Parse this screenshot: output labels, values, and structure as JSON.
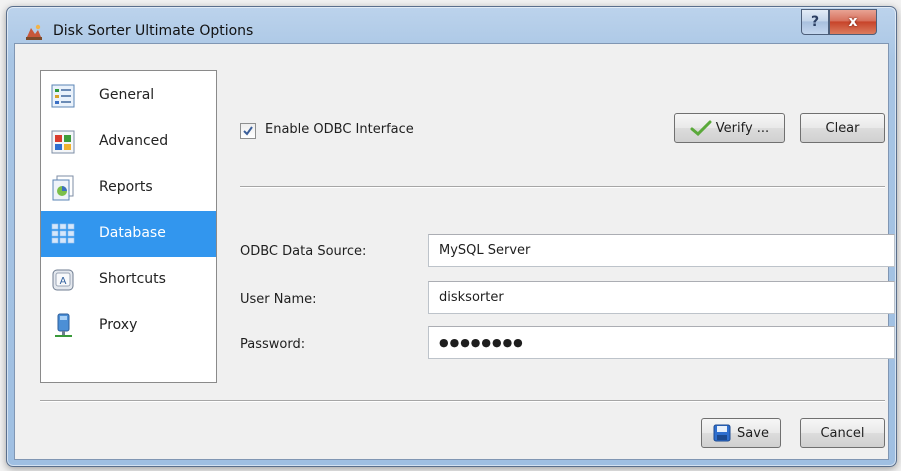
{
  "window": {
    "title": "Disk Sorter Ultimate Options"
  },
  "title_buttons": {
    "help": "?",
    "close": "x"
  },
  "categories": [
    {
      "label": "General",
      "icon": "general-settings-icon"
    },
    {
      "label": "Advanced",
      "icon": "advanced-settings-icon"
    },
    {
      "label": "Reports",
      "icon": "reports-icon"
    },
    {
      "label": "Database",
      "icon": "database-icon",
      "selected": true
    },
    {
      "label": "Shortcuts",
      "icon": "shortcut-key-icon"
    },
    {
      "label": "Proxy",
      "icon": "proxy-icon"
    }
  ],
  "database": {
    "enable_odbc": {
      "label": "Enable ODBC Interface",
      "checked": true
    },
    "verify_label": "Verify ...",
    "clear_label": "Clear",
    "fields": {
      "data_source": {
        "label": "ODBC Data Source:",
        "value": "MySQL Server"
      },
      "user_name": {
        "label": "User Name:",
        "value": "disksorter"
      },
      "password": {
        "label": "Password:",
        "value": "●●●●●●●●"
      }
    }
  },
  "footer": {
    "save_label": "Save",
    "cancel_label": "Cancel"
  },
  "colors": {
    "selection": "#3296ee",
    "accent_check": "#5aa93a"
  }
}
